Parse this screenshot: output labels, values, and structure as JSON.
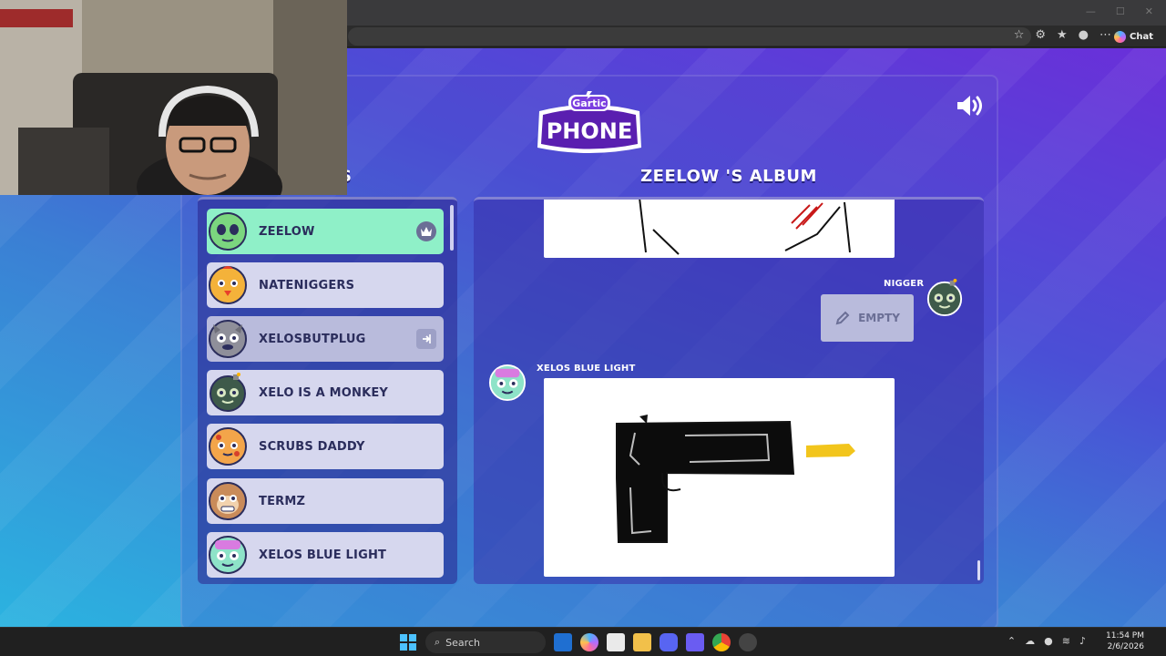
{
  "browser": {
    "chat_label": "Chat"
  },
  "game": {
    "logo_top": "Gartic",
    "logo_bottom": "PHONE",
    "players_heading": "RS",
    "album_title": "ZEELOW 'S ALBUM",
    "players": [
      {
        "name": "ZEELOW",
        "state": "active",
        "badge": "crown-icon",
        "avatar_color": "#7bd67f"
      },
      {
        "name": "NATENIGGERS",
        "state": "normal",
        "badge": "",
        "avatar_color": "#f4b23a"
      },
      {
        "name": "XELOSBUTPLUG",
        "state": "ghost",
        "badge": "exit-icon",
        "avatar_color": "#8f8f9a"
      },
      {
        "name": "XELO IS A MONKEY",
        "state": "normal",
        "badge": "",
        "avatar_color": "#3e5a4a"
      },
      {
        "name": "SCRUBS DADDY",
        "state": "normal",
        "badge": "",
        "avatar_color": "#f3a54a"
      },
      {
        "name": "TERMZ",
        "state": "normal",
        "badge": "",
        "avatar_color": "#c98b5a"
      },
      {
        "name": "XELOS BLUE LIGHT",
        "state": "normal",
        "badge": "",
        "avatar_color": "#8ee3c8"
      }
    ],
    "album": {
      "reply_author": "NIGGER",
      "reply_text": "EMPTY",
      "drawing_author": "XELOS BLUE LIGHT"
    }
  },
  "taskbar": {
    "search_placeholder": "Search",
    "time": "11:54 PM",
    "date": "2/6/2026"
  },
  "colors": {
    "active_row": "#8ff0c8",
    "row": "#d6d7ee",
    "ghost_row": "#b9bbdc",
    "title_text": "#ffffff",
    "name_text": "#2b2d5c"
  }
}
